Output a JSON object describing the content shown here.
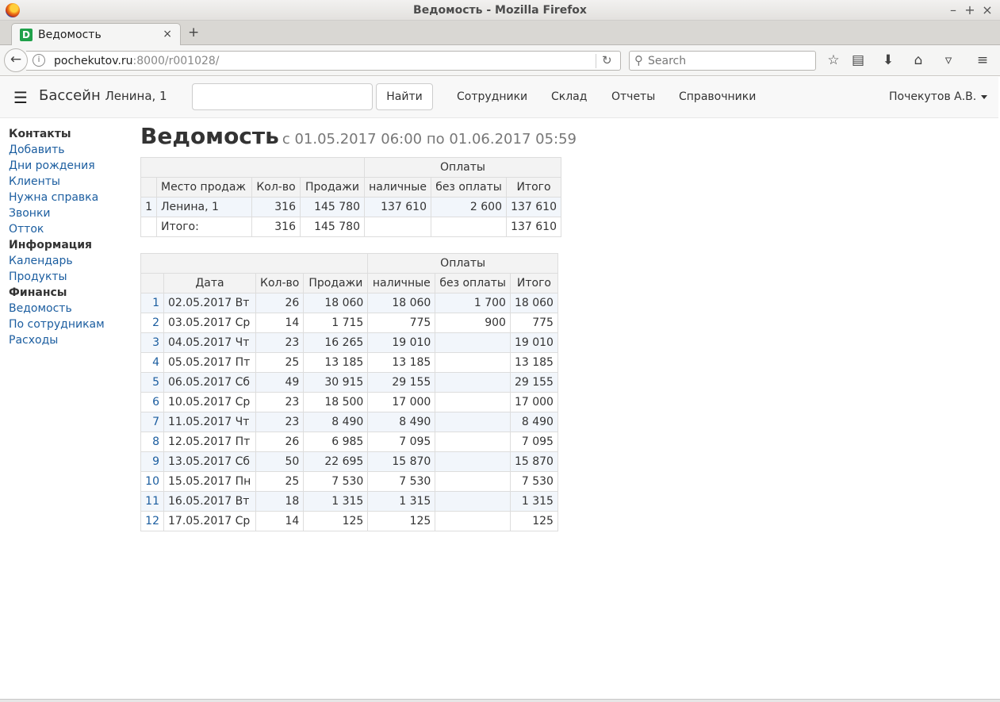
{
  "window": {
    "title": "Ведомость - Mozilla Firefox"
  },
  "browser": {
    "tab_title": "Ведомость",
    "favicon_letter": "D",
    "url_host": "pochekutov.ru",
    "url_rest": ":8000/r001028/",
    "search_placeholder": "Search"
  },
  "navbar": {
    "brand": "Бассейн",
    "brand_sub": "Ленина, 1",
    "search_value": "",
    "find_label": "Найти",
    "links": [
      "Сотрудники",
      "Склад",
      "Отчеты",
      "Справочники"
    ],
    "user": "Почекутов А.В."
  },
  "sidebar": [
    {
      "section": "Контакты",
      "items": [
        "Добавить",
        "Дни рождения",
        "Клиенты",
        "Нужна справка",
        "Звонки",
        "Отток"
      ]
    },
    {
      "section": "Информация",
      "items": [
        "Календарь",
        "Продукты"
      ]
    },
    {
      "section": "Финансы",
      "items": [
        "Ведомость",
        "По сотрудникам",
        "Расходы"
      ]
    }
  ],
  "page": {
    "title": "Ведомость",
    "period": "с 01.05.2017 06:00 по 01.06.2017 05:59"
  },
  "summary_table": {
    "group_header": "Оплаты",
    "headers": [
      "Место продаж",
      "Кол-во",
      "Продажи",
      "наличные",
      "без оплаты",
      "Итого"
    ],
    "rows": [
      {
        "idx": "1",
        "place": "Ленина, 1",
        "qty": "316",
        "sales": "145 780",
        "cash": "137 610",
        "unpaid": "2 600",
        "total": "137 610"
      }
    ],
    "totals": {
      "label": "Итого:",
      "qty": "316",
      "sales": "145 780",
      "cash": "",
      "unpaid": "",
      "total": "137 610"
    }
  },
  "daily_table": {
    "group_header": "Оплаты",
    "headers": [
      "Дата",
      "Кол-во",
      "Продажи",
      "наличные",
      "без оплаты",
      "Итого"
    ],
    "rows": [
      {
        "idx": "1",
        "date": "02.05.2017 Вт",
        "qty": "26",
        "sales": "18 060",
        "cash": "18 060",
        "unpaid": "1 700",
        "total": "18 060"
      },
      {
        "idx": "2",
        "date": "03.05.2017 Ср",
        "qty": "14",
        "sales": "1 715",
        "cash": "775",
        "unpaid": "900",
        "total": "775"
      },
      {
        "idx": "3",
        "date": "04.05.2017 Чт",
        "qty": "23",
        "sales": "16 265",
        "cash": "19 010",
        "unpaid": "",
        "total": "19 010"
      },
      {
        "idx": "4",
        "date": "05.05.2017 Пт",
        "qty": "25",
        "sales": "13 185",
        "cash": "13 185",
        "unpaid": "",
        "total": "13 185"
      },
      {
        "idx": "5",
        "date": "06.05.2017 Сб",
        "qty": "49",
        "sales": "30 915",
        "cash": "29 155",
        "unpaid": "",
        "total": "29 155"
      },
      {
        "idx": "6",
        "date": "10.05.2017 Ср",
        "qty": "23",
        "sales": "18 500",
        "cash": "17 000",
        "unpaid": "",
        "total": "17 000"
      },
      {
        "idx": "7",
        "date": "11.05.2017 Чт",
        "qty": "23",
        "sales": "8 490",
        "cash": "8 490",
        "unpaid": "",
        "total": "8 490"
      },
      {
        "idx": "8",
        "date": "12.05.2017 Пт",
        "qty": "26",
        "sales": "6 985",
        "cash": "7 095",
        "unpaid": "",
        "total": "7 095"
      },
      {
        "idx": "9",
        "date": "13.05.2017 Сб",
        "qty": "50",
        "sales": "22 695",
        "cash": "15 870",
        "unpaid": "",
        "total": "15 870"
      },
      {
        "idx": "10",
        "date": "15.05.2017 Пн",
        "qty": "25",
        "sales": "7 530",
        "cash": "7 530",
        "unpaid": "",
        "total": "7 530"
      },
      {
        "idx": "11",
        "date": "16.05.2017 Вт",
        "qty": "18",
        "sales": "1 315",
        "cash": "1 315",
        "unpaid": "",
        "total": "1 315"
      },
      {
        "idx": "12",
        "date": "17.05.2017 Ср",
        "qty": "14",
        "sales": "125",
        "cash": "125",
        "unpaid": "",
        "total": "125"
      }
    ]
  }
}
